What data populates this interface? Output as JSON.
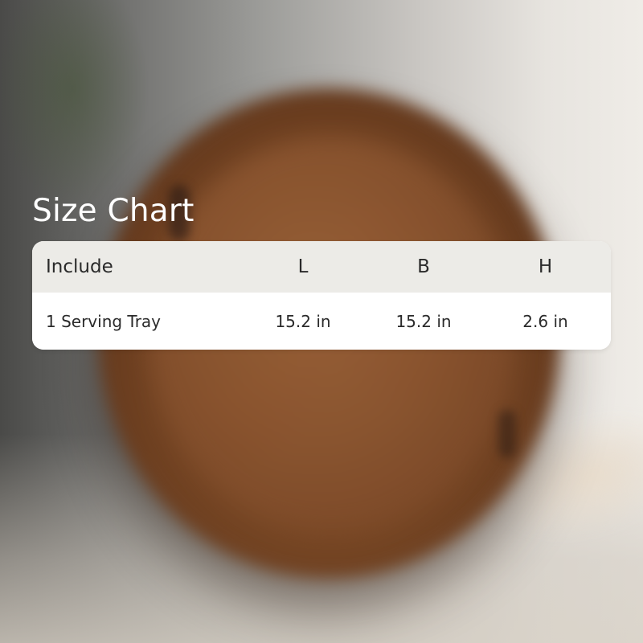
{
  "title": "Size Chart",
  "table": {
    "headers": {
      "include": "Include",
      "l": "L",
      "b": "B",
      "h": "H"
    },
    "rows": [
      {
        "include": "1 Serving Tray",
        "l": "15.2 in",
        "b": "15.2 in",
        "h": "2.6 in"
      }
    ]
  },
  "colors": {
    "header_background": "#ecebe7",
    "row_background": "#ffffff",
    "title_text": "#ffffff",
    "table_text": "#2a2a2a"
  }
}
